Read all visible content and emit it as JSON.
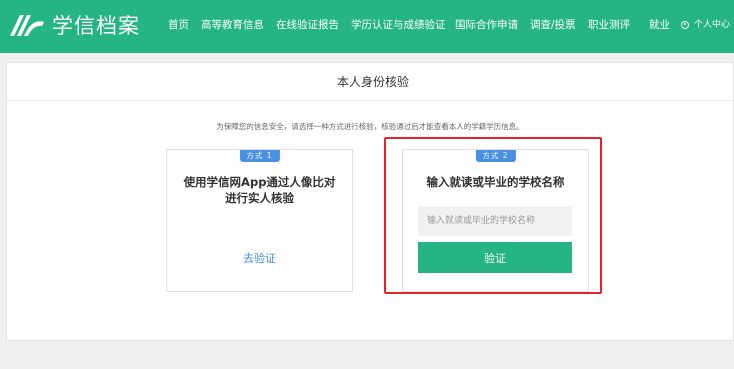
{
  "header": {
    "logo_text": "学信档案",
    "nav": [
      {
        "label": "首页"
      },
      {
        "label": "高等教育信息"
      },
      {
        "label": "在线验证报告"
      },
      {
        "label": "学历认证与成绩验证"
      },
      {
        "label": "国际合作申请"
      },
      {
        "label": "调查/投票"
      },
      {
        "label": "职业测评"
      },
      {
        "label": "就业"
      }
    ],
    "user_label": "个人中心"
  },
  "page": {
    "title": "本人身份核验",
    "note": "为保障您的信息安全，请选择一种方式进行核验，核验通过后才能查看本人的学籍学历信息。"
  },
  "option1": {
    "badge": "方式 1",
    "heading_line1": "使用学信网App通过人像比对",
    "heading_line2": "进行实人核验",
    "link": "去验证"
  },
  "option2": {
    "badge": "方式 2",
    "heading": "输入就读或毕业的学校名称",
    "input_placeholder": "输入就读或毕业的学校名称",
    "input_value": "",
    "button": "验证"
  },
  "colors": {
    "brand_green": "#25b583",
    "link_blue": "#4a90e2",
    "highlight_red": "#e0262b"
  }
}
